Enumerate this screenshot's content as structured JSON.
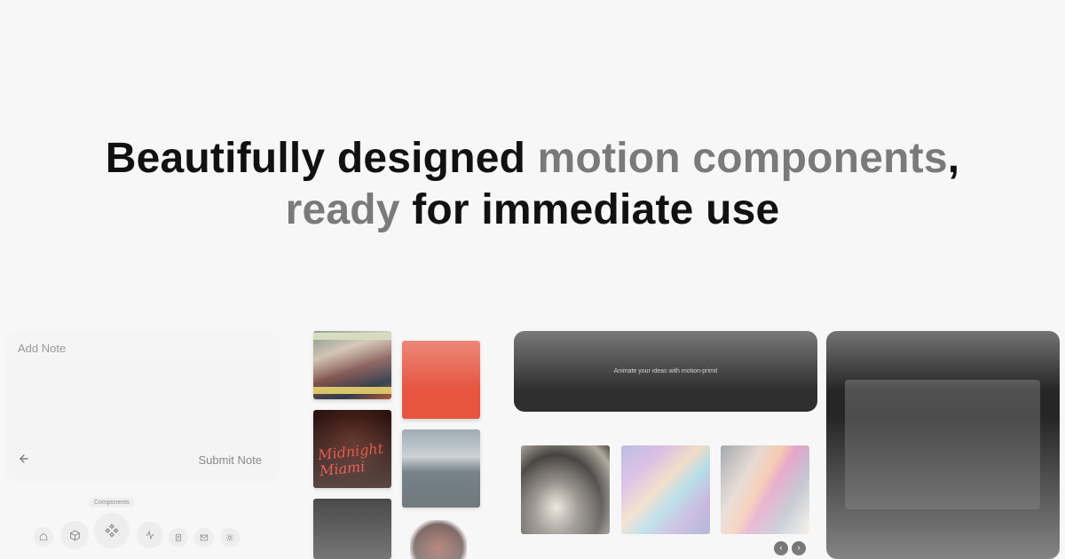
{
  "hero": {
    "line1_dark": "Beautifully designed ",
    "line1_muted": "motion components",
    "line1_comma": ",",
    "line2_muted": "ready",
    "line2_dark": " for immediate use"
  },
  "note_panel": {
    "input_placeholder": "Add Note",
    "submit_label": "Submit Note",
    "back_icon": "arrow-left-icon"
  },
  "dock": {
    "tooltip": "Components",
    "items": [
      {
        "icon": "home-icon"
      },
      {
        "icon": "package-icon"
      },
      {
        "icon": "components-icon"
      },
      {
        "icon": "activity-icon"
      },
      {
        "icon": "scroll-icon"
      },
      {
        "icon": "mail-icon"
      },
      {
        "icon": "sun-icon"
      }
    ]
  },
  "albums": {
    "cover_2_title": "Midnight Miami"
  },
  "dark_panel": {
    "text": "Animate your ideas with motion-primit"
  },
  "carousel": {
    "prev_icon": "chevron-left-icon",
    "next_icon": "chevron-right-icon",
    "prev_glyph": "‹",
    "next_glyph": "›"
  },
  "colors": {
    "background": "#f7f7f7",
    "text_dark": "#111111",
    "text_muted": "#7a7a7a",
    "panel_dark": "#2f2f2f",
    "album_orange": "#e6553f"
  }
}
